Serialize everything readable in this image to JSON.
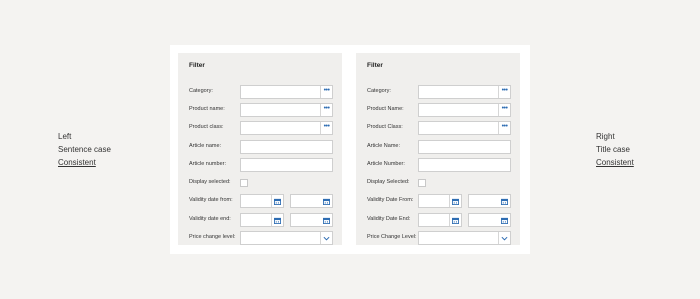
{
  "left_caption": {
    "line1": "Left",
    "line2": "Sentence case",
    "line3": "Consistent"
  },
  "right_caption": {
    "line1": "Right",
    "line2": "Title case",
    "line3": "Consistent"
  },
  "panels": {
    "left": {
      "title": "Filter",
      "category": "Category:",
      "product_name": "Product name:",
      "product_class": "Product class:",
      "article_name": "Article name:",
      "article_number": "Article number:",
      "display_selected": "Display selected:",
      "validity_from": "Validity date from:",
      "validity_end": "Validity date end:",
      "price_change": "Price change level:"
    },
    "right": {
      "title": "Filter",
      "category": "Category:",
      "product_name": "Product Name:",
      "product_class": "Product Class:",
      "article_name": "Article Name:",
      "article_number": "Article Number:",
      "display_selected": "Display Selected:",
      "validity_from": "Validity Date From:",
      "validity_end": "Validity Date End:",
      "price_change": "Price Change Level:"
    }
  },
  "icons": {
    "lookup": "ellipsis-icon",
    "date": "calendar-icon",
    "select": "chevron-down-icon"
  },
  "colors": {
    "accent": "#2e6db3",
    "background": "#f4f3f1",
    "panel": "#f0efed"
  }
}
